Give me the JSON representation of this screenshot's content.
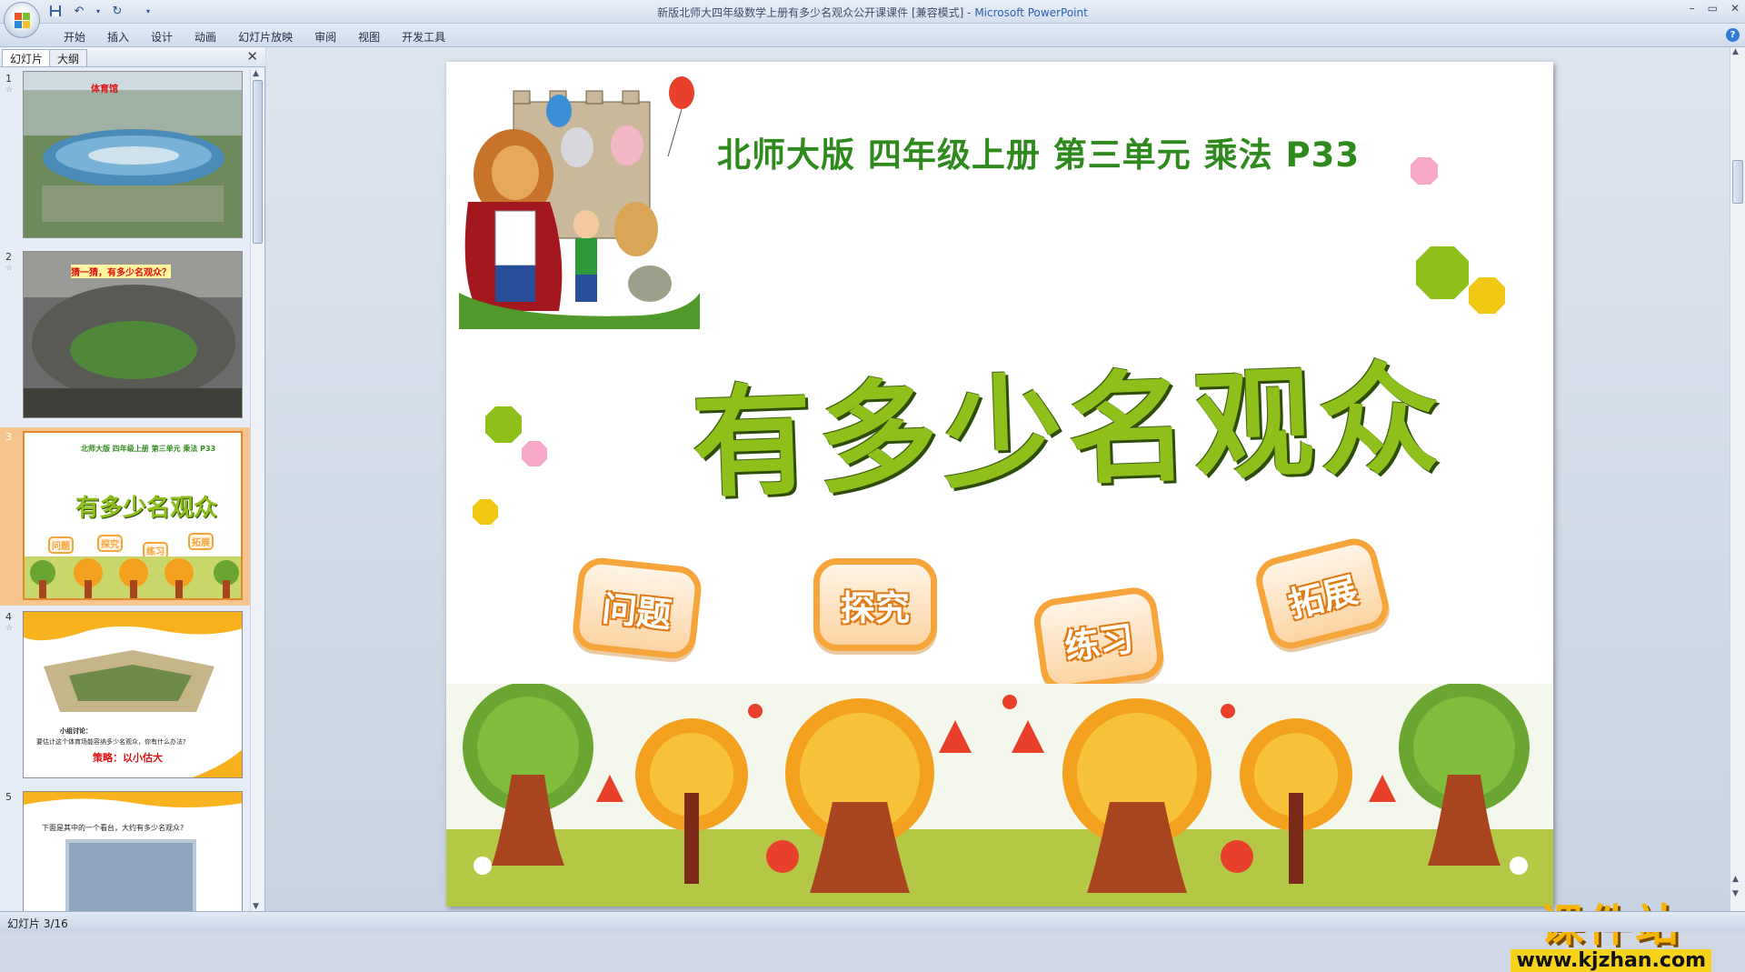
{
  "window": {
    "title_doc": "新版北师大四年级数学上册有多少名观众公开课课件 [兼容模式] - ",
    "title_app": "Microsoft PowerPoint",
    "minimize": "–",
    "restore": "▭",
    "close": "✕"
  },
  "ribbon": {
    "tabs": [
      "开始",
      "插入",
      "设计",
      "动画",
      "幻灯片放映",
      "审阅",
      "视图",
      "开发工具"
    ],
    "help": "?"
  },
  "qat": {
    "save_icon": "save-icon",
    "undo_icon": "undo-icon",
    "redo_icon": "redo-icon"
  },
  "left_panel": {
    "tab_slides": "幻灯片",
    "tab_outline": "大纲",
    "close": "✕",
    "thumbnails": [
      {
        "num": "1",
        "caption": "体育馆"
      },
      {
        "num": "2",
        "caption": "猜一猜，有多少名观众？"
      },
      {
        "num": "3",
        "caption": "北师大版  四年级上册  第三单元  乘法  P33",
        "title": "有多少名观众",
        "btns": [
          "问题",
          "探究",
          "练习",
          "拓展"
        ]
      },
      {
        "num": "4",
        "caption": "要估计这个体育场能容纳多少名观众，你有什么办法?",
        "strategy": "策略：以小估大",
        "sub": "小组讨论："
      },
      {
        "num": "5",
        "caption": "下面是其中的一个看台，大约有多少名观众?"
      }
    ]
  },
  "slide": {
    "header": "北师大版  四年级上册  第三单元  乘法  P33",
    "title": "有多少名观众",
    "buttons": [
      "问题",
      "探究",
      "练习",
      "拓展"
    ],
    "colors": {
      "green": "#8fbf1a",
      "dark_green": "#2f8a1e",
      "orange": "#f6a53a",
      "pink": "#f7a8c8",
      "yellow": "#f0c814"
    }
  },
  "watermark": {
    "main": "课件站",
    "url": "www.kjzhan.com"
  },
  "status": {
    "text": "幻灯片 3/16"
  }
}
